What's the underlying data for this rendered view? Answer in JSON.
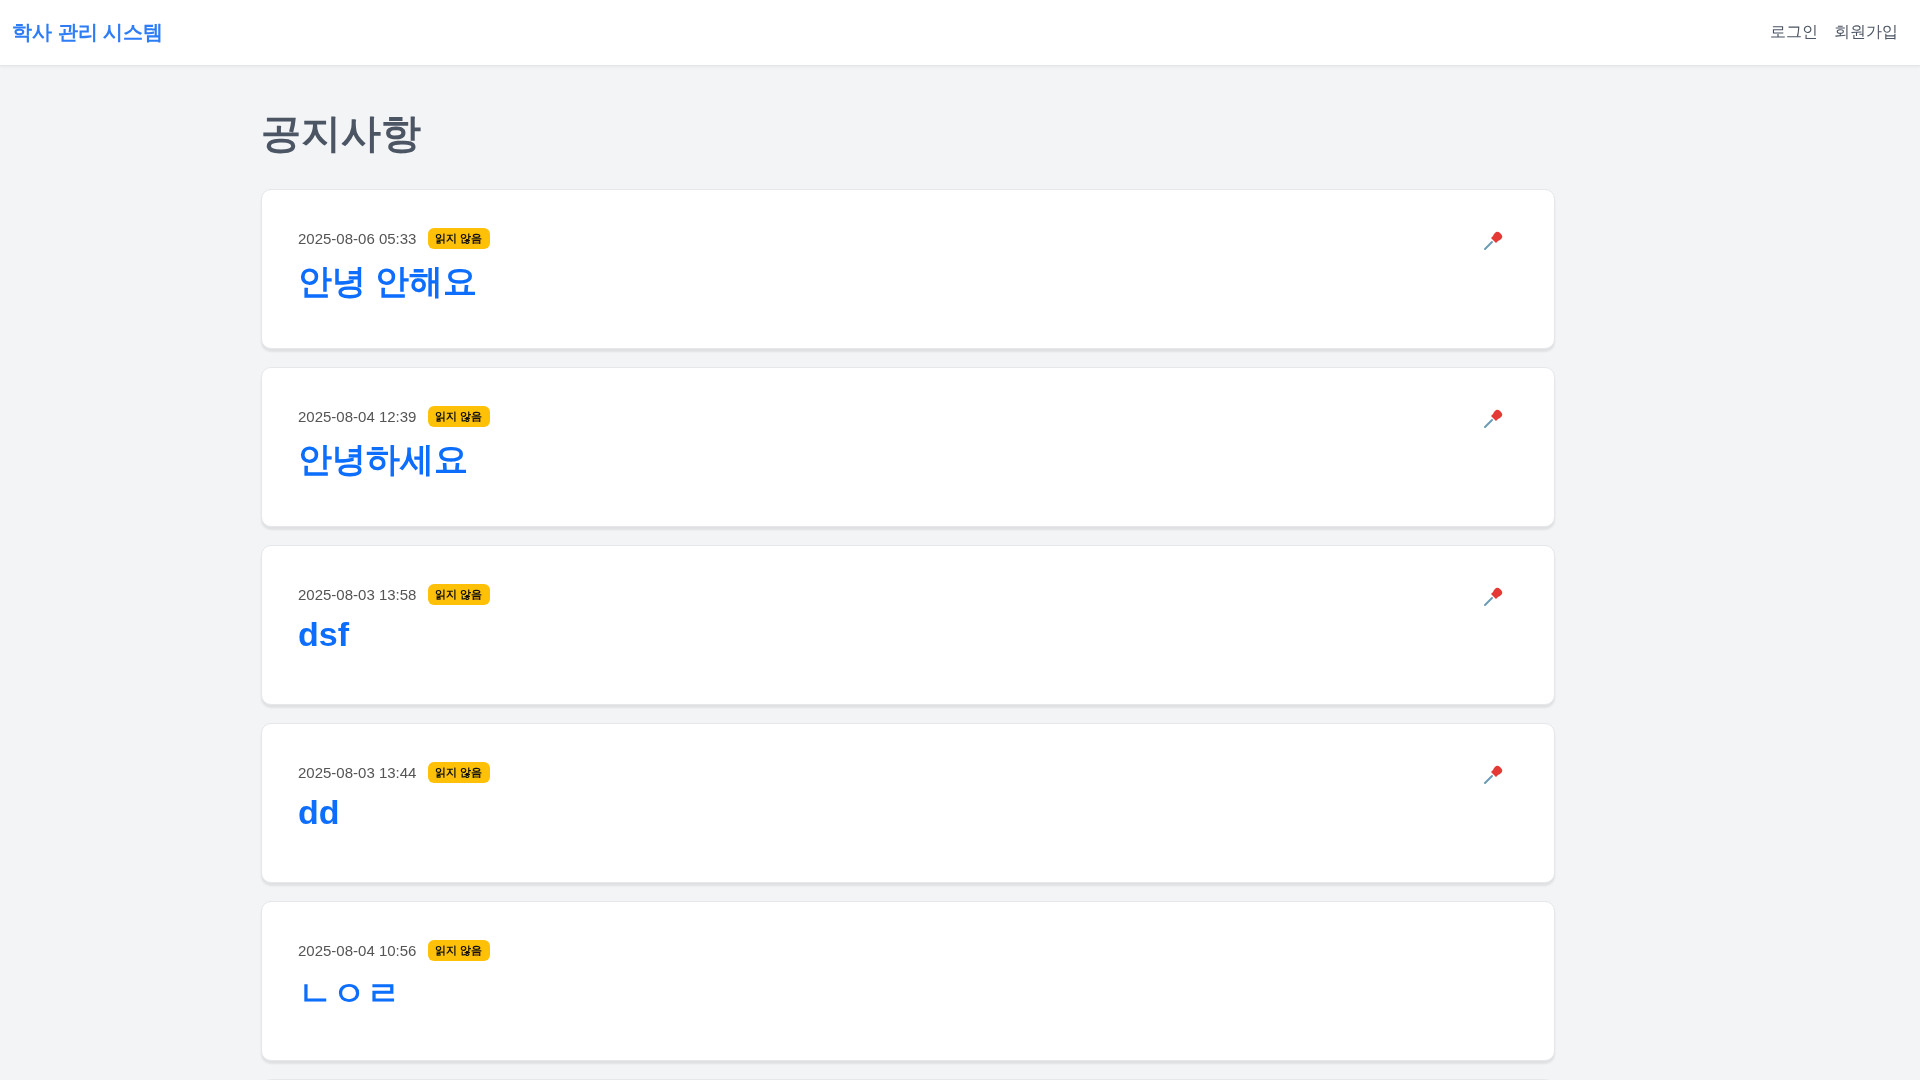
{
  "header": {
    "brand": "학사 관리 시스템",
    "links": [
      "로그인",
      "회원가입"
    ]
  },
  "page_title": "공지사항",
  "notices": [
    {
      "date": "2025-08-06 05:33",
      "badge": "읽지 않음",
      "title": "안녕 안해요",
      "pinned": true
    },
    {
      "date": "2025-08-04 12:39",
      "badge": "읽지 않음",
      "title": "안녕하세요",
      "pinned": true
    },
    {
      "date": "2025-08-03 13:58",
      "badge": "읽지 않음",
      "title": "dsf",
      "pinned": true
    },
    {
      "date": "2025-08-03 13:44",
      "badge": "읽지 않음",
      "title": "dd",
      "pinned": true
    },
    {
      "date": "2025-08-04 10:56",
      "badge": "읽지 않음",
      "title": "ㄴㅇㄹ",
      "pinned": false
    }
  ]
}
